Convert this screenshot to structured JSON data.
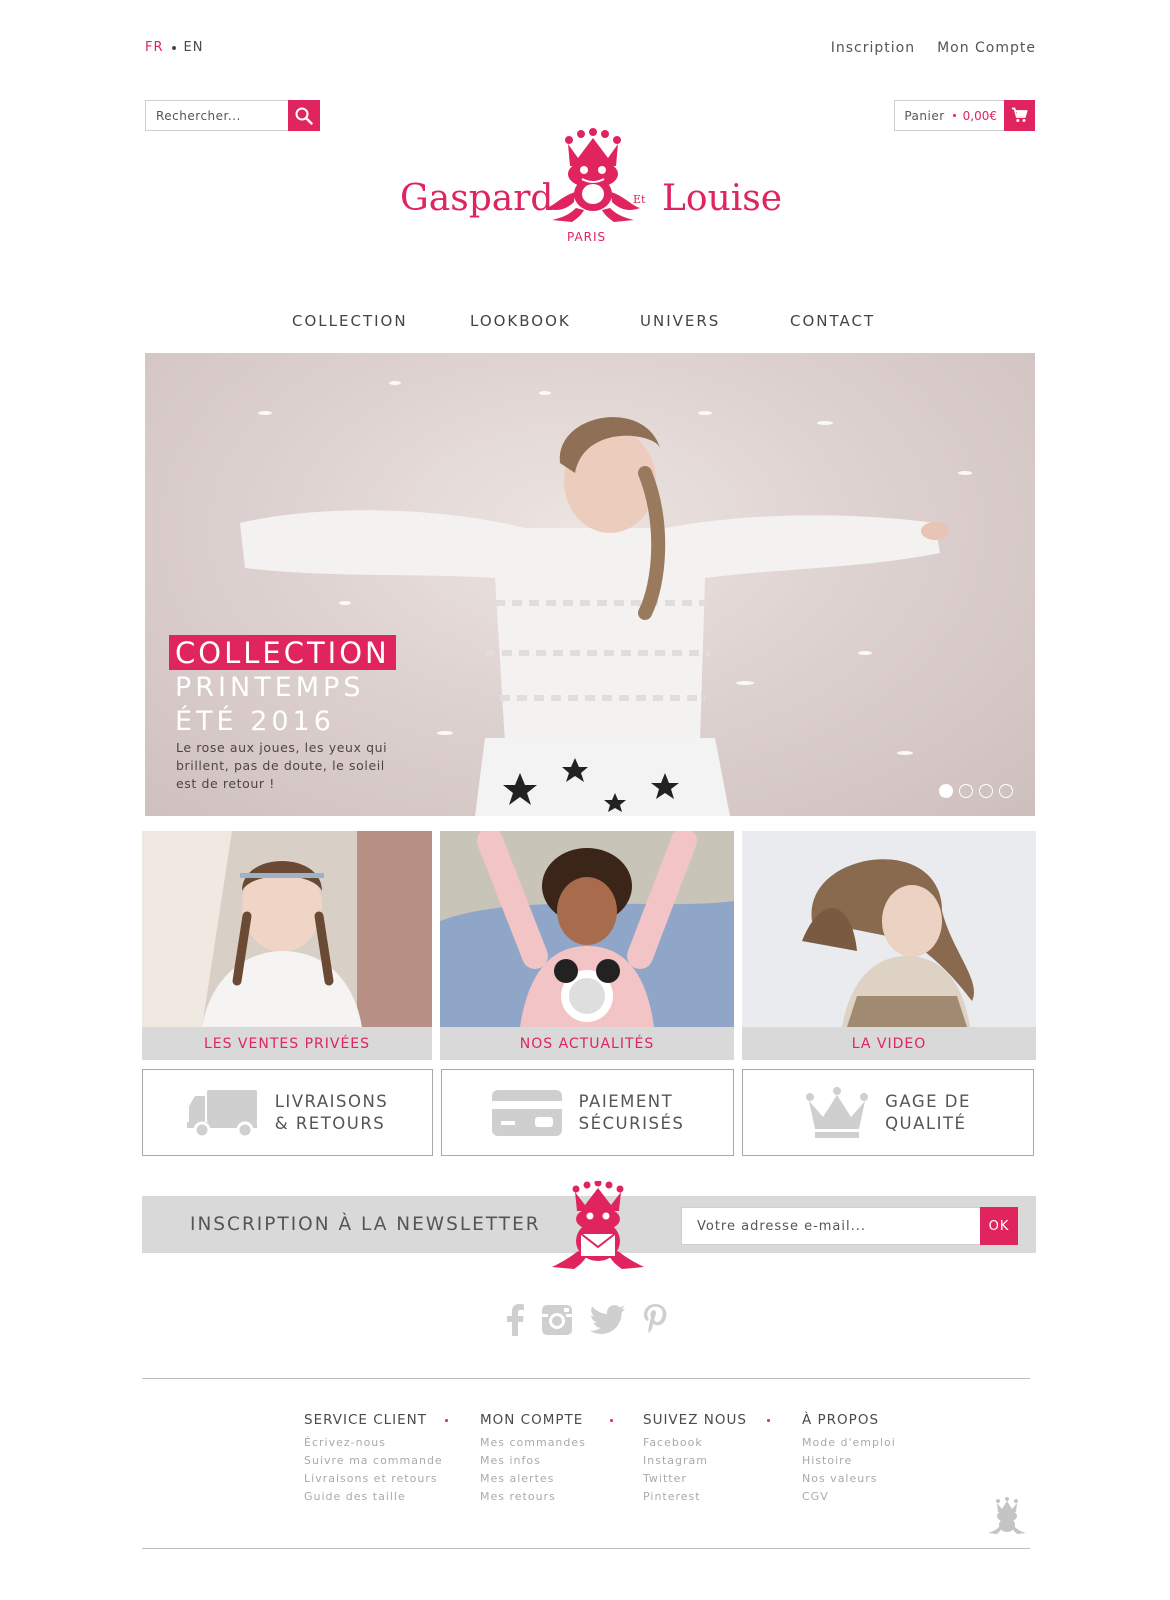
{
  "header": {
    "lang_fr": "FR",
    "lang_en": "EN",
    "inscription": "Inscription",
    "mon_compte": "Mon Compte",
    "search_placeholder": "Rechercher...",
    "cart_label": "Panier",
    "cart_amount": "0,00€"
  },
  "brand": {
    "name_left": "Gaspard",
    "name_et": "Et",
    "name_right": "Louise",
    "city": "PARIS"
  },
  "nav": [
    "COLLECTION",
    "LOOKBOOK",
    "UNIVERS",
    "CONTACT"
  ],
  "hero": {
    "badge": "COLLECTION",
    "line1": "PRINTEMPS",
    "line2": "ÉTÉ 2016",
    "description": "Le rose aux joues, les yeux qui brillent, pas de doute, le soleil est de retour !",
    "slides_total": 4,
    "slide_active": 1
  },
  "tiles": [
    "LES VENTES PRIVÉES",
    "NOS ACTUALITÉS",
    "LA VIDEO"
  ],
  "features": [
    {
      "line1": "LIVRAISONS",
      "line2": "& RETOURS",
      "icon": "truck-icon"
    },
    {
      "line1": "PAIEMENT",
      "line2": "SÉCURISÉS",
      "icon": "credit-card-icon"
    },
    {
      "line1": "GAGE DE",
      "line2": "QUALITÉ",
      "icon": "crown-icon"
    }
  ],
  "newsletter": {
    "title": "INSCRIPTION À LA NEWSLETTER",
    "placeholder": "Votre adresse e-mail...",
    "submit": "OK"
  },
  "social": [
    "facebook-icon",
    "instagram-icon",
    "twitter-icon",
    "pinterest-icon"
  ],
  "footer": {
    "columns": [
      {
        "title": "SERVICE CLIENT",
        "links": [
          "Écrivez-nous",
          "Suivre ma commande",
          "Livraisons et retours",
          "Guide des taille"
        ]
      },
      {
        "title": "MON COMPTE",
        "links": [
          "Mes commandes",
          "Mes infos",
          "Mes alertes",
          "Mes retours"
        ]
      },
      {
        "title": "SUIVEZ NOUS",
        "links": [
          "Facebook",
          "Instagram",
          "Twitter",
          "Pinterest"
        ]
      },
      {
        "title": "À PROPOS",
        "links": [
          "Mode d'emploi",
          "Histoire",
          "Nos valeurs",
          "CGV"
        ]
      }
    ]
  },
  "colors": {
    "accent": "#e0245e",
    "gray_band": "#d9d9d9",
    "icon_gray": "#cfcfcf"
  }
}
